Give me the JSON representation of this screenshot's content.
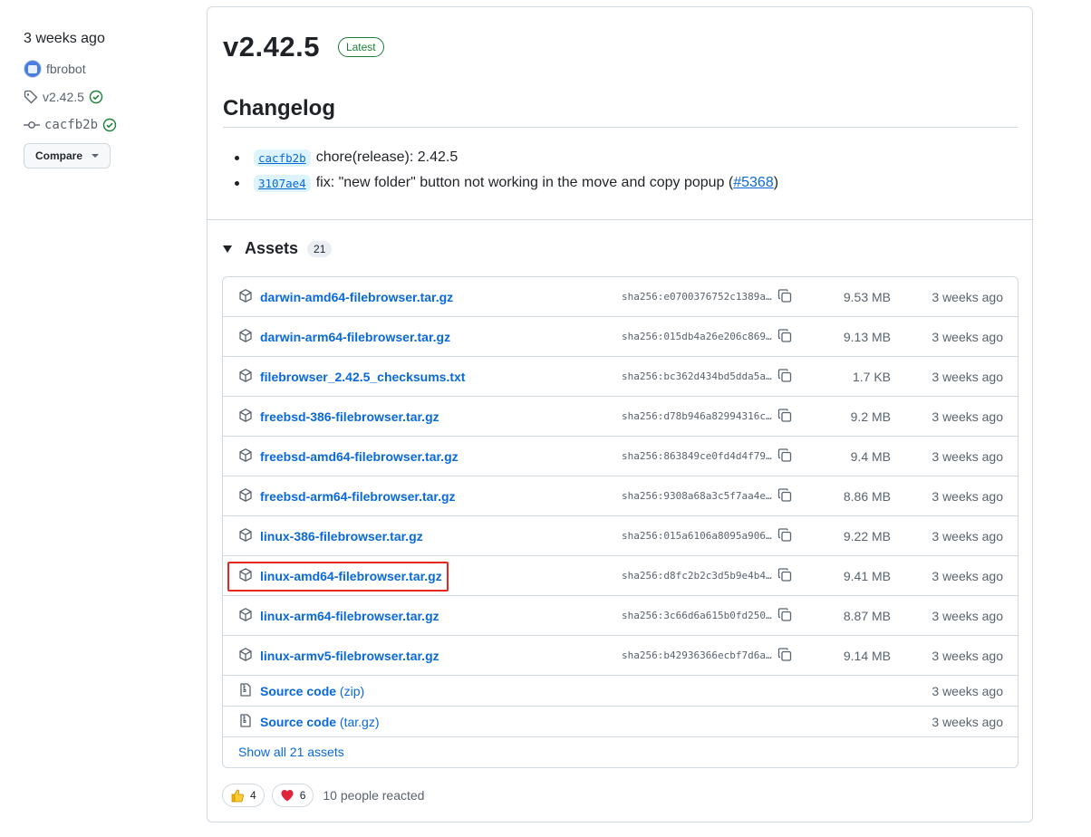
{
  "sidebar": {
    "time": "3 weeks ago",
    "author": "fbrobot",
    "tag": "v2.42.5",
    "commit": "cacfb2b",
    "compare_label": "Compare"
  },
  "release": {
    "title": "v2.42.5",
    "latest_label": "Latest",
    "changelog_heading": "Changelog",
    "changelog": [
      {
        "sha": "cacfb2b",
        "text": "chore(release): 2.42.5",
        "link": "",
        "suffix_open": "",
        "suffix_close": ""
      },
      {
        "sha": "3107ae4",
        "text": "fix: \"new folder\" button not working in the move and copy popup",
        "suffix_open": " (",
        "link": "#5368",
        "suffix_close": ")"
      }
    ]
  },
  "assets": {
    "heading": "Assets",
    "count": "21",
    "items": [
      {
        "name": "darwin-amd64-filebrowser.tar.gz",
        "sha": "sha256:e0700376752c1389a…",
        "size": "9.53 MB",
        "time": "3 weeks ago"
      },
      {
        "name": "darwin-arm64-filebrowser.tar.gz",
        "sha": "sha256:015db4a26e206c869…",
        "size": "9.13 MB",
        "time": "3 weeks ago"
      },
      {
        "name": "filebrowser_2.42.5_checksums.txt",
        "sha": "sha256:bc362d434bd5dda5a…",
        "size": "1.7 KB",
        "time": "3 weeks ago"
      },
      {
        "name": "freebsd-386-filebrowser.tar.gz",
        "sha": "sha256:d78b946a82994316c…",
        "size": "9.2 MB",
        "time": "3 weeks ago"
      },
      {
        "name": "freebsd-amd64-filebrowser.tar.gz",
        "sha": "sha256:863849ce0fd4d4f79…",
        "size": "9.4 MB",
        "time": "3 weeks ago"
      },
      {
        "name": "freebsd-arm64-filebrowser.tar.gz",
        "sha": "sha256:9308a68a3c5f7aa4e…",
        "size": "8.86 MB",
        "time": "3 weeks ago"
      },
      {
        "name": "linux-386-filebrowser.tar.gz",
        "sha": "sha256:015a6106a8095a906…",
        "size": "9.22 MB",
        "time": "3 weeks ago"
      },
      {
        "name": "linux-amd64-filebrowser.tar.gz",
        "sha": "sha256:d8fc2b2c3d5b9e4b4…",
        "size": "9.41 MB",
        "time": "3 weeks ago",
        "highlighted": true
      },
      {
        "name": "linux-arm64-filebrowser.tar.gz",
        "sha": "sha256:3c66d6a615b0fd250…",
        "size": "8.87 MB",
        "time": "3 weeks ago"
      },
      {
        "name": "linux-armv5-filebrowser.tar.gz",
        "sha": "sha256:b42936366ecbf7d6a…",
        "size": "9.14 MB",
        "time": "3 weeks ago"
      }
    ],
    "source": [
      {
        "name": "Source code",
        "kind": "(zip)",
        "time": "3 weeks ago"
      },
      {
        "name": "Source code",
        "kind": "(tar.gz)",
        "time": "3 weeks ago"
      }
    ],
    "show_all": "Show all 21 assets"
  },
  "reactions": {
    "items": [
      {
        "emoji": "thumbs-up-icon",
        "count": "4"
      },
      {
        "emoji": "heart-icon",
        "count": "6"
      }
    ],
    "summary": "10 people reacted"
  },
  "colors": {
    "link": "#0969da",
    "latest": "#1a7f37",
    "highlight": "#e5281e"
  }
}
